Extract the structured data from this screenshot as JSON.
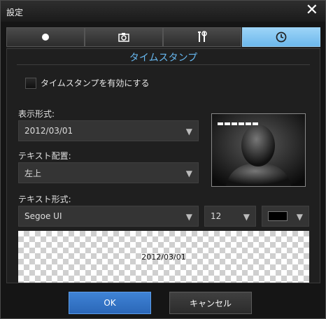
{
  "window": {
    "title": "設定"
  },
  "tabs": [
    {
      "icon": "circle-icon",
      "active": false
    },
    {
      "icon": "camera-icon",
      "active": false
    },
    {
      "icon": "tools-icon",
      "active": false
    },
    {
      "icon": "clock-icon",
      "active": true
    }
  ],
  "section": {
    "title": "タイムスタンプ",
    "enable_label": "タイムスタンプを有効にする"
  },
  "format": {
    "label": "表示形式:",
    "value": "2012/03/01"
  },
  "position": {
    "label": "テキスト配置:",
    "value": "左上"
  },
  "text_format": {
    "label": "テキスト形式:",
    "font": "Segoe UI",
    "size": "12",
    "color": "#000000"
  },
  "preview": {
    "text": "2012/03/01"
  },
  "buttons": {
    "ok": "OK",
    "cancel": "キャンセル"
  }
}
